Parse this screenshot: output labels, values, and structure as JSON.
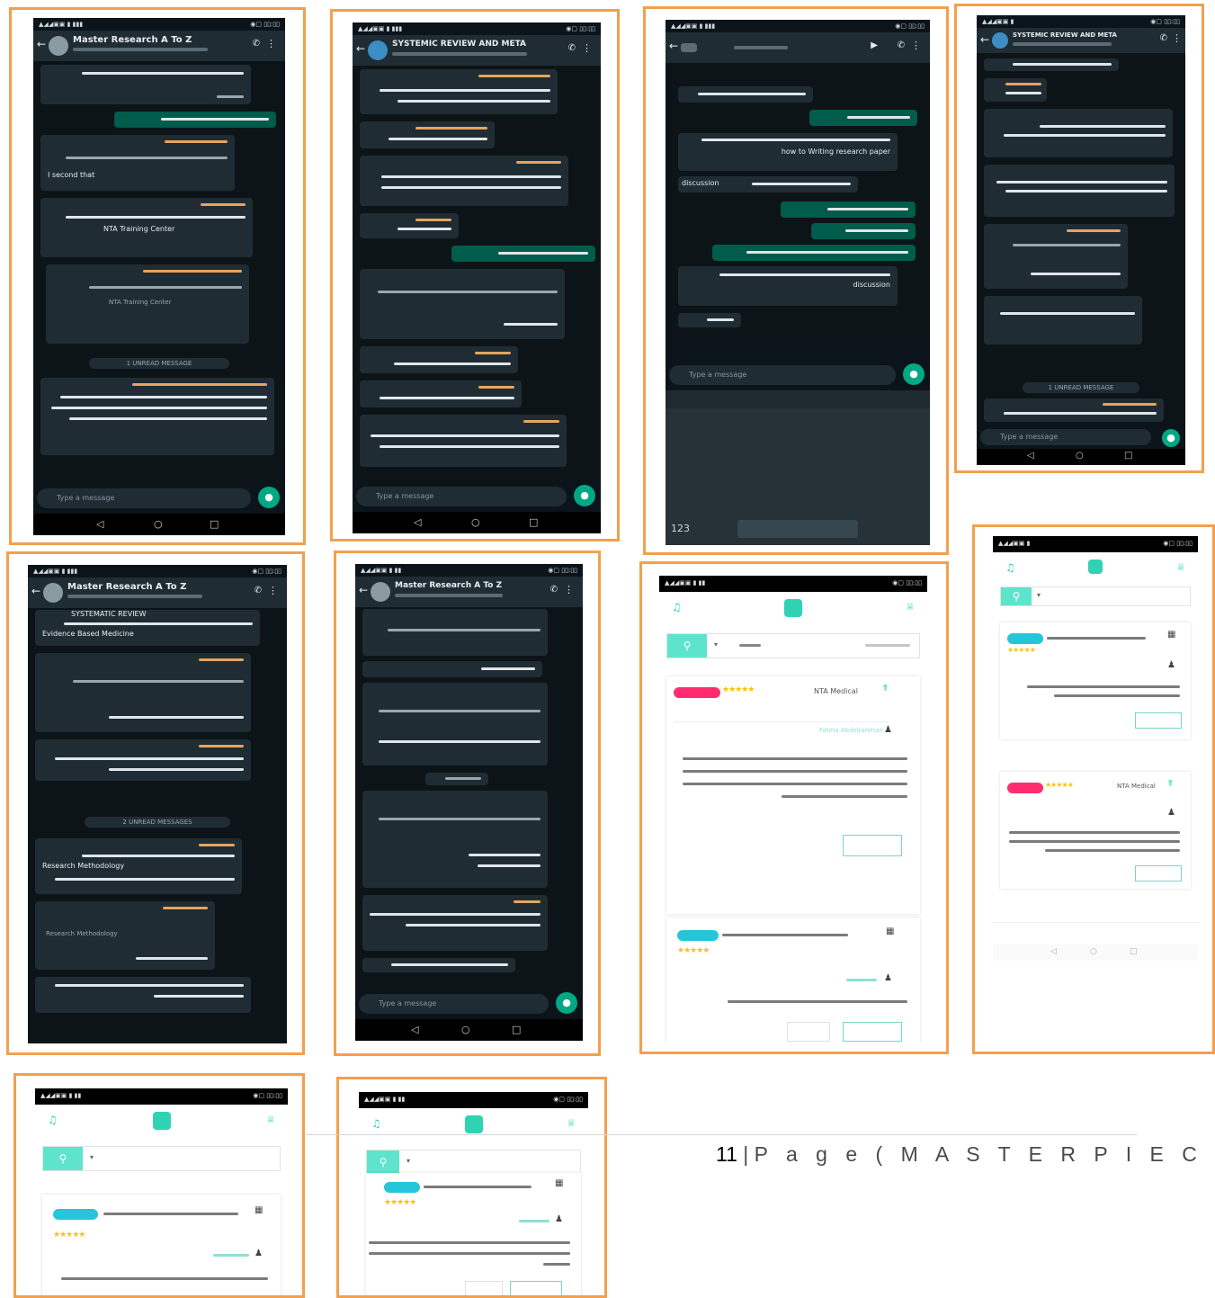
{
  "document": {
    "page_number": "11",
    "separator": "|",
    "footer_text": "P a g e ( M A S T E R P I E C E )",
    "frame_color": "#F2A04E",
    "accent_color": "#2fd3b4"
  },
  "chats": {
    "master_research": {
      "title": "Master Research A To Z",
      "input_placeholder": "Type a message",
      "unread_1": "1 UNREAD MESSAGE",
      "line_1": "I second that",
      "line_2": "NTA Training Center",
      "line_3": "NTA Training Center"
    },
    "systemic_review": {
      "title": "SYSTEMIC REVIEW AND META",
      "input_placeholder": "Type a message"
    },
    "private": {
      "line_1": "how to Writing research paper",
      "line_2": "discussion",
      "line_3": "discussion",
      "input_placeholder": "Type a message",
      "keyboard_num": "123"
    },
    "systemic_review_2": {
      "title": "SYSTEMIC REVIEW AND META",
      "unread": "1 UNREAD MESSAGE",
      "input_placeholder": "Type a message"
    },
    "master_research_2": {
      "title": "Master Research A To Z",
      "line_1": "SYSTEMATIC REVIEW",
      "line_2": "Evidence Based Medicine",
      "unread": "2 UNREAD MESSAGES",
      "line_3": "Research Methodology",
      "line_4": "Research Methodology"
    },
    "master_research_3": {
      "title": "Master Research A To Z",
      "input_placeholder": "Type a message"
    }
  },
  "app_reviews": {
    "panel_1": {
      "instructor": "NTA Medical",
      "reviewer": "Fatma Abdelrahman"
    },
    "panel_2": {
      "instructor": "NTA Medical"
    }
  }
}
